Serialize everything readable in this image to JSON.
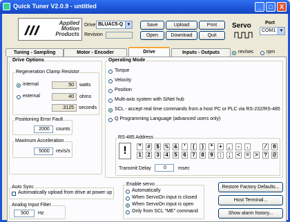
{
  "window": {
    "title": "Quick Tuner V2.0.9 - untitled",
    "minimize": "_",
    "maximize": "□",
    "close": "X"
  },
  "logo": {
    "line1": "Applied",
    "line2": "Motion",
    "line3": "Products"
  },
  "toolbar": {
    "drive_label": "Drive",
    "drive_value": "BLUAC5-Q",
    "revision_label": "Revision",
    "save": "Save",
    "open": "Open",
    "upload": "Upload",
    "download": "Download",
    "print": "Print",
    "quit": "Quit",
    "servo": "Servo",
    "port_label": "Port",
    "port_value": "COM1"
  },
  "tabs": [
    "Tuning - Sampling",
    "Motor - Encoder",
    "Drive",
    "Inputs - Outputs"
  ],
  "units": {
    "revsec": "rev/sec",
    "rpm": "rpm",
    "revsec_selected": true
  },
  "drive_options": {
    "title": "Drive Options",
    "regen": {
      "title": "Regeneration Clamp Resistor",
      "internal": "internal",
      "external": "external",
      "selected": "internal",
      "watts_value": "50",
      "watts_unit": "watts",
      "ohms_value": "40",
      "ohms_unit": "ohms",
      "seconds_value": ".3125",
      "seconds_unit": "seconds"
    },
    "pos_error": {
      "title": "Positioning Error Fault",
      "value": "2000",
      "unit": "counts"
    },
    "max_accel": {
      "title": "Maximum Acceleration",
      "value": "5000",
      "unit": "rev/s/s"
    }
  },
  "operating_mode": {
    "title": "Operating Mode",
    "options": [
      "Torque",
      "Velocity",
      "Position",
      "Multi-axis system with SiNet hub",
      "SCL - accept real time commands from a host PC or PLC via RS-232/RS-485",
      "Q Programming Language (advanced users only)"
    ],
    "selected_index": 4
  },
  "rs485": {
    "title": "RS-485 Address",
    "selected_char": "!",
    "row1": [
      "\"",
      "#",
      "$",
      "%",
      "&",
      "'",
      "(",
      ")",
      "*",
      "+",
      ",",
      "-",
      ".",
      "/",
      "0"
    ],
    "row2": [
      "1",
      "2",
      "3",
      "4",
      "5",
      "6",
      "7",
      "8",
      "9",
      ":",
      ";",
      "<",
      "=",
      ">",
      "?",
      "@"
    ],
    "transmit_label": "Transmit Delay",
    "transmit_value": "0",
    "transmit_unit": "msec"
  },
  "auto_sync": {
    "title": "Auto Sync",
    "label": "Automatically upload from drive at power up"
  },
  "analog_filter": {
    "title": "Analog Input Filter",
    "value": "500",
    "unit": "Hz"
  },
  "enable_servo": {
    "title": "Enable servo",
    "options": [
      "Automatically",
      "When ServoOn input is closed",
      "When ServoOn input is open",
      "Only from SCL \"ME\" command"
    ],
    "selected_index": 2
  },
  "side_buttons": {
    "restore": "Restore Factory Defaults...",
    "host": "Host Terminal...",
    "alarm": "Show alarm history..."
  }
}
